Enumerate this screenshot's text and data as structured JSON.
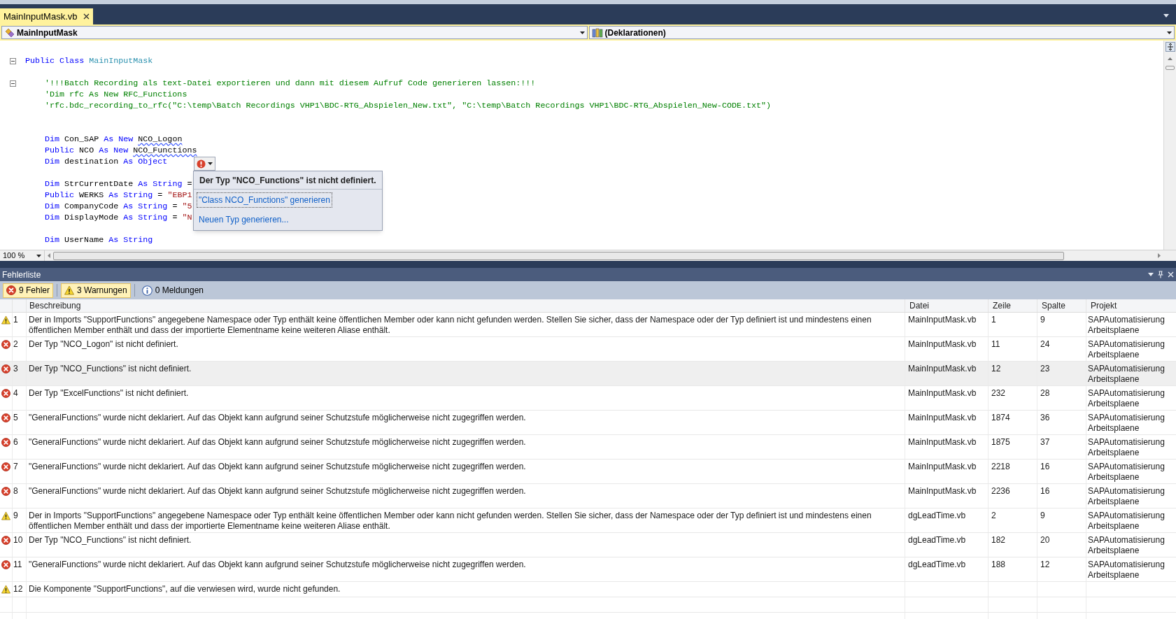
{
  "tabs": [
    {
      "label": "MainInputMask.vb",
      "selected": true
    }
  ],
  "navigation": {
    "type_dropdown": "MainInputMask",
    "member_dropdown": "(Deklarationen)"
  },
  "code_lines": [
    {
      "kind": "code",
      "collapsible": true,
      "tokens": [
        {
          "kind": "keyword",
          "text": "Public Class "
        },
        {
          "kind": "type",
          "text": "MainInputMask"
        }
      ],
      "children": [
        {
          "kind": "blank"
        },
        {
          "kind": "code",
          "collapsible": true,
          "tokens": [
            {
              "kind": "comment",
              "text": "'!!!Batch Recording als text-Datei exportieren und dann mit diesem Aufruf Code generieren lassen:!!!"
            }
          ]
        },
        {
          "kind": "code",
          "collapsible": false,
          "tokens": [
            {
              "kind": "comment",
              "text": "'Dim rfc As New RFC_Functions"
            }
          ]
        },
        {
          "kind": "code",
          "collapsible": false,
          "tokens": [
            {
              "kind": "comment",
              "text": "'rfc.bdc_recording_to_rfc(\"C:\\temp\\Batch Recordings VHP1\\BDC-RTG_Abspielen_New.txt\", \"C:\\temp\\Batch Recordings VHP1\\BDC-RTG_Abspielen_New-CODE.txt\")"
            }
          ]
        },
        {
          "kind": "blank"
        },
        {
          "kind": "blank"
        },
        {
          "kind": "code",
          "collapsible": false,
          "tokens": [
            {
              "kind": "keyword",
              "text": "Dim "
            },
            {
              "kind": "plain",
              "text": "Con_SAP "
            },
            {
              "kind": "keyword",
              "text": "As New "
            },
            {
              "kind": "unresolved",
              "text": "NCO_Logon"
            }
          ]
        },
        {
          "kind": "code",
          "collapsible": false,
          "tokens": [
            {
              "kind": "keyword",
              "text": "Public "
            },
            {
              "kind": "plain",
              "text": "NCO "
            },
            {
              "kind": "keyword",
              "text": "As New "
            },
            {
              "kind": "unresolved",
              "text": "NCO_Functions"
            }
          ]
        },
        {
          "kind": "code",
          "collapsible": false,
          "tokens": [
            {
              "kind": "keyword",
              "text": "Dim "
            },
            {
              "kind": "plain",
              "text": "destination "
            },
            {
              "kind": "keyword",
              "text": "As Object"
            }
          ]
        },
        {
          "kind": "blank"
        },
        {
          "kind": "code",
          "collapsible": false,
          "tokens": [
            {
              "kind": "keyword",
              "text": "Dim "
            },
            {
              "kind": "plain",
              "text": "StrCurrentDate "
            },
            {
              "kind": "keyword",
              "text": "As String "
            },
            {
              "kind": "plain",
              "text": "="
            }
          ]
        },
        {
          "kind": "code",
          "collapsible": false,
          "tokens": [
            {
              "kind": "keyword",
              "text": "Public "
            },
            {
              "kind": "plain",
              "text": "WERKS "
            },
            {
              "kind": "keyword",
              "text": "As String "
            },
            {
              "kind": "plain",
              "text": "= "
            },
            {
              "kind": "string",
              "text": "\"EBP1"
            }
          ]
        },
        {
          "kind": "code",
          "collapsible": false,
          "tokens": [
            {
              "kind": "keyword",
              "text": "Dim "
            },
            {
              "kind": "plain",
              "text": "CompanyCode "
            },
            {
              "kind": "keyword",
              "text": "As String "
            },
            {
              "kind": "plain",
              "text": "= "
            },
            {
              "kind": "string",
              "text": "\"5"
            }
          ]
        },
        {
          "kind": "code",
          "collapsible": false,
          "tokens": [
            {
              "kind": "keyword",
              "text": "Dim "
            },
            {
              "kind": "plain",
              "text": "DisplayMode "
            },
            {
              "kind": "keyword",
              "text": "As String "
            },
            {
              "kind": "plain",
              "text": "= "
            },
            {
              "kind": "string",
              "text": "\"N"
            }
          ]
        },
        {
          "kind": "blank"
        },
        {
          "kind": "code",
          "collapsible": false,
          "tokens": [
            {
              "kind": "keyword",
              "text": "Dim "
            },
            {
              "kind": "plain",
              "text": "UserName "
            },
            {
              "kind": "keyword",
              "text": "As String"
            }
          ]
        }
      ]
    }
  ],
  "smart_tag": {
    "message": "Der Typ \"NCO_Functions\" ist nicht definiert.",
    "actions": [
      {
        "label": "\"Class NCO_Functions\" generieren",
        "focused": true
      },
      {
        "label": "Neuen Typ generieren...",
        "focused": false
      }
    ]
  },
  "zoom": "100 %",
  "error_list": {
    "title": "Fehlerliste",
    "filters": [
      {
        "kind": "error",
        "label": "9 Fehler",
        "selected": true
      },
      {
        "kind": "warning",
        "label": "3 Warnungen",
        "selected": true
      },
      {
        "kind": "info",
        "label": "0 Meldungen",
        "selected": false
      }
    ],
    "columns": [
      "Beschreibung",
      "Datei",
      "Zeile",
      "Spalte",
      "Projekt"
    ],
    "rows": [
      {
        "kind": "warning",
        "number": "1",
        "description": "Der in Imports \"SupportFunctions\" angegebene Namespace oder Typ enthält keine öffentlichen Member oder kann nicht gefunden werden. Stellen Sie sicher, dass der Namespace oder der Typ definiert ist und mindestens einen öffentlichen Member enthält und dass der importierte Elementname keine weiteren Aliase enthält.",
        "file": "MainInputMask.vb",
        "line": "1",
        "column": "9",
        "project": "SAPAutomatisierung Arbeitsplaene",
        "selected": false
      },
      {
        "kind": "error",
        "number": "2",
        "description": "Der Typ \"NCO_Logon\" ist nicht definiert.",
        "file": "MainInputMask.vb",
        "line": "11",
        "column": "24",
        "project": "SAPAutomatisierung Arbeitsplaene",
        "selected": false
      },
      {
        "kind": "error",
        "number": "3",
        "description": "Der Typ \"NCO_Functions\" ist nicht definiert.",
        "file": "MainInputMask.vb",
        "line": "12",
        "column": "23",
        "project": "SAPAutomatisierung Arbeitsplaene",
        "selected": true
      },
      {
        "kind": "error",
        "number": "4",
        "description": "Der Typ \"ExcelFunctions\" ist nicht definiert.",
        "file": "MainInputMask.vb",
        "line": "232",
        "column": "28",
        "project": "SAPAutomatisierung Arbeitsplaene",
        "selected": false
      },
      {
        "kind": "error",
        "number": "5",
        "description": "\"GeneralFunctions\" wurde nicht deklariert. Auf das Objekt kann aufgrund seiner Schutzstufe möglicherweise nicht zugegriffen werden.",
        "file": "MainInputMask.vb",
        "line": "1874",
        "column": "36",
        "project": "SAPAutomatisierung Arbeitsplaene",
        "selected": false
      },
      {
        "kind": "error",
        "number": "6",
        "description": "\"GeneralFunctions\" wurde nicht deklariert. Auf das Objekt kann aufgrund seiner Schutzstufe möglicherweise nicht zugegriffen werden.",
        "file": "MainInputMask.vb",
        "line": "1875",
        "column": "37",
        "project": "SAPAutomatisierung Arbeitsplaene",
        "selected": false
      },
      {
        "kind": "error",
        "number": "7",
        "description": "\"GeneralFunctions\" wurde nicht deklariert. Auf das Objekt kann aufgrund seiner Schutzstufe möglicherweise nicht zugegriffen werden.",
        "file": "MainInputMask.vb",
        "line": "2218",
        "column": "16",
        "project": "SAPAutomatisierung Arbeitsplaene",
        "selected": false
      },
      {
        "kind": "error",
        "number": "8",
        "description": "\"GeneralFunctions\" wurde nicht deklariert. Auf das Objekt kann aufgrund seiner Schutzstufe möglicherweise nicht zugegriffen werden.",
        "file": "MainInputMask.vb",
        "line": "2236",
        "column": "16",
        "project": "SAPAutomatisierung Arbeitsplaene",
        "selected": false
      },
      {
        "kind": "warning",
        "number": "9",
        "description": "Der in Imports \"SupportFunctions\" angegebene Namespace oder Typ enthält keine öffentlichen Member oder kann nicht gefunden werden. Stellen Sie sicher, dass der Namespace oder der Typ definiert ist und mindestens einen öffentlichen Member enthält und dass der importierte Elementname keine weiteren Aliase enthält.",
        "file": "dgLeadTime.vb",
        "line": "2",
        "column": "9",
        "project": "SAPAutomatisierung Arbeitsplaene",
        "selected": false
      },
      {
        "kind": "error",
        "number": "10",
        "description": "Der Typ \"NCO_Functions\" ist nicht definiert.",
        "file": "dgLeadTime.vb",
        "line": "182",
        "column": "20",
        "project": "SAPAutomatisierung Arbeitsplaene",
        "selected": false
      },
      {
        "kind": "error",
        "number": "11",
        "description": "\"GeneralFunctions\" wurde nicht deklariert. Auf das Objekt kann aufgrund seiner Schutzstufe möglicherweise nicht zugegriffen werden.",
        "file": "dgLeadTime.vb",
        "line": "188",
        "column": "12",
        "project": "SAPAutomatisierung Arbeitsplaene",
        "selected": false
      },
      {
        "kind": "warning",
        "number": "12",
        "description": "Die Komponente \"SupportFunctions\", auf die verwiesen wird, wurde nicht gefunden.",
        "selected": false
      }
    ]
  }
}
